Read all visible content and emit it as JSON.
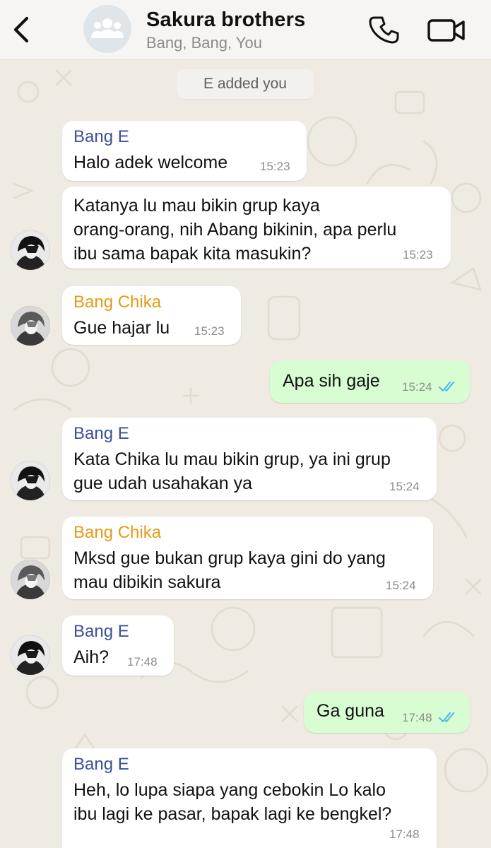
{
  "header": {
    "back_icon": "chevron-left-icon",
    "title": "Sakura brothers",
    "subtitle": "Bang, Bang, You",
    "call_icon": "phone-icon",
    "video_icon": "video-camera-icon"
  },
  "system_message": "E added you",
  "colors": {
    "incoming": "#ffffff",
    "outgoing": "#d9fdd3",
    "sender_e": "#3d4f9a",
    "sender_chika": "#e59a16",
    "read_ticks": "#53bdeb"
  },
  "messages": [
    {
      "sender": "Bang E",
      "lines": [
        "Halo adek welcome"
      ],
      "time": "15:23"
    },
    {
      "sender": "",
      "lines": [
        "Katanya lu mau bikin grup kaya",
        "orang-orang, nih Abang bikinin, apa perlu",
        "ibu sama bapak kita masukin?"
      ],
      "time": "15:23"
    },
    {
      "sender": "Bang Chika",
      "lines": [
        "Gue hajar lu"
      ],
      "time": "15:23"
    },
    {
      "sender": "",
      "lines": [
        "Apa sih gaje"
      ],
      "time": "15:24",
      "status": "read"
    },
    {
      "sender": "Bang E",
      "lines": [
        "Kata Chika lu mau bikin grup, ya ini grup",
        "gue udah usahakan ya"
      ],
      "time": "15:24"
    },
    {
      "sender": "Bang Chika",
      "lines": [
        "Mksd gue bukan grup kaya gini do yang",
        "mau dibikin sakura"
      ],
      "time": "15:24"
    },
    {
      "sender": "Bang E",
      "lines": [
        "Aih?"
      ],
      "time": "17:48"
    },
    {
      "sender": "",
      "lines": [
        "Ga guna"
      ],
      "time": "17:48",
      "status": "read"
    },
    {
      "sender": "Bang E",
      "lines": [
        "Heh, lo lupa siapa yang cebokin Lo kalo",
        "ibu lagi ke pasar, bapak lagi ke bengkel?"
      ],
      "time": "17:48"
    }
  ]
}
